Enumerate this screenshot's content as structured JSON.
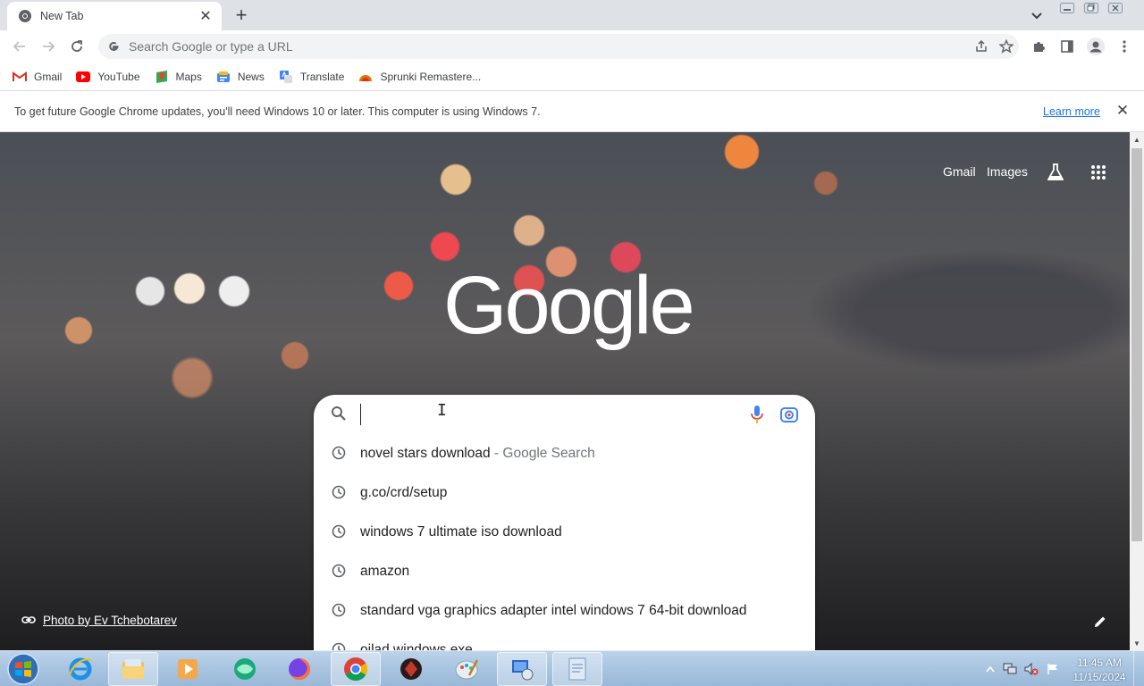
{
  "tab": {
    "title": "New Tab"
  },
  "omnibox": {
    "placeholder": "Search Google or type a URL"
  },
  "bookmarks": [
    {
      "label": "Gmail",
      "icon": "gmail-icon"
    },
    {
      "label": "YouTube",
      "icon": "youtube-icon"
    },
    {
      "label": "Maps",
      "icon": "maps-icon"
    },
    {
      "label": "News",
      "icon": "news-icon"
    },
    {
      "label": "Translate",
      "icon": "translate-icon"
    },
    {
      "label": "Sprunki Remastere...",
      "icon": "sprunki-icon"
    }
  ],
  "infobar": {
    "message": "To get future Google Chrome updates, you'll need Windows 10 or later. This computer is using Windows 7.",
    "link": "Learn more"
  },
  "ntp": {
    "gmail": "Gmail",
    "images": "Images",
    "logo": "Google",
    "photo_credit": "Photo by Ev Tchebotarev"
  },
  "suggestions": [
    {
      "text": "novel stars download",
      "sub": " - Google Search"
    },
    {
      "text": "g.co/crd/setup",
      "sub": ""
    },
    {
      "text": "windows 7 ultimate iso download",
      "sub": ""
    },
    {
      "text": "amazon",
      "sub": ""
    },
    {
      "text": "standard vga graphics adapter intel windows 7 64-bit download",
      "sub": ""
    },
    {
      "text": "oilad windows exe",
      "sub": ""
    }
  ],
  "taskbar": {
    "time": "11:45 AM",
    "date": "11/15/2024",
    "apps": [
      "internet-explorer-icon",
      "file-explorer-icon",
      "media-player-icon",
      "app-icon",
      "firefox-icon",
      "chrome-icon",
      "game-icon",
      "paint-icon",
      "network-icon",
      "notepad-icon"
    ]
  },
  "colors": {
    "accent": "#1a73e8",
    "tabstrip": "#dee1e6",
    "taskbar": "#a8c4e0"
  }
}
